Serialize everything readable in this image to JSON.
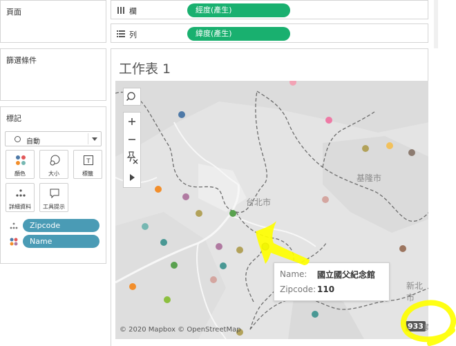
{
  "left_panel": {
    "pages_title": "頁面",
    "filters_title": "篩選條件",
    "marks": {
      "title": "標記",
      "mark_type": "自動",
      "buttons": [
        {
          "label": "顏色",
          "icon": "color-dots-icon"
        },
        {
          "label": "大小",
          "icon": "size-icon"
        },
        {
          "label": "標籤",
          "icon": "text-label-icon"
        },
        {
          "label": "詳細資料",
          "icon": "detail-dots-icon"
        },
        {
          "label": "工具提示",
          "icon": "tooltip-icon"
        }
      ],
      "fields": [
        {
          "label": "Zipcode",
          "icon": "detail-dots-icon"
        },
        {
          "label": "Name",
          "icon": "color-dots-icon"
        }
      ]
    }
  },
  "shelves": {
    "columns_label": "欄",
    "columns_pill": "經度(產生)",
    "rows_label": "列",
    "rows_pill": "緯度(產生)"
  },
  "worksheet": {
    "title": "工作表 1",
    "map_labels": {
      "taipei": "台北市",
      "keelung": "基隆市",
      "new_taipei": "新北市"
    },
    "attribution": "© 2020 Mapbox © OpenStreetMap",
    "tooltip": {
      "name_key": "Name:",
      "name_value": "國立國父紀念館",
      "zip_key": "Zipcode:",
      "zip_value": "110"
    },
    "mark_count": "933",
    "mark_count_suffix": "項",
    "colors": {
      "pill_blue": "#4a9bb5",
      "pill_green": "#19b06f",
      "map_bg": "#e6e6e6",
      "highlight": "#ffff00"
    }
  }
}
